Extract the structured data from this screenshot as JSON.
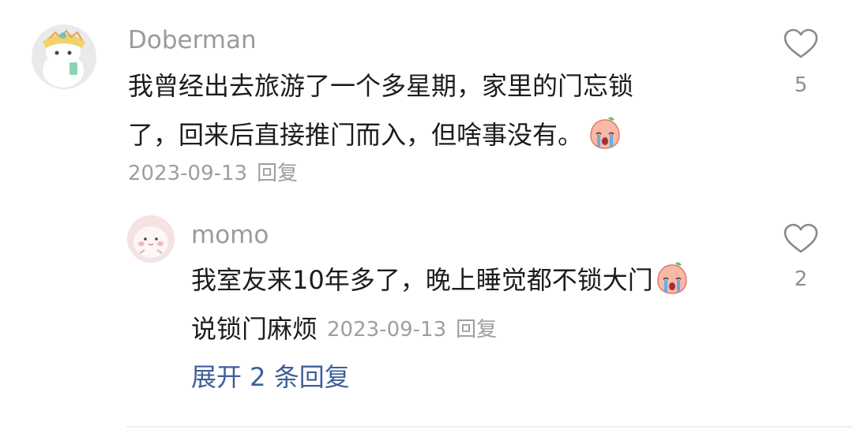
{
  "comment": {
    "username": "Doberman",
    "text_line1": "我曾经出去旅游了一个多星期，家里的门忘锁",
    "text_line2": "了，回来后直接推门而入，但啥事没有。",
    "date": "2023-09-13",
    "reply_label": "回复",
    "likes": "5",
    "emoji": "crying-emoji"
  },
  "reply": {
    "username": "momo",
    "text_line1": "我室友来10年多了，晚上睡觉都不锁大门",
    "text_line2": "说锁门麻烦",
    "date": "2023-09-13",
    "reply_label": "回复",
    "likes": "2",
    "emoji": "crying-emoji"
  },
  "expand_label": "展开 2 条回复",
  "colors": {
    "username": "#9b9b9b",
    "text": "#1c1c1c",
    "meta": "#9e9e9e",
    "link": "#3d5f9a"
  }
}
